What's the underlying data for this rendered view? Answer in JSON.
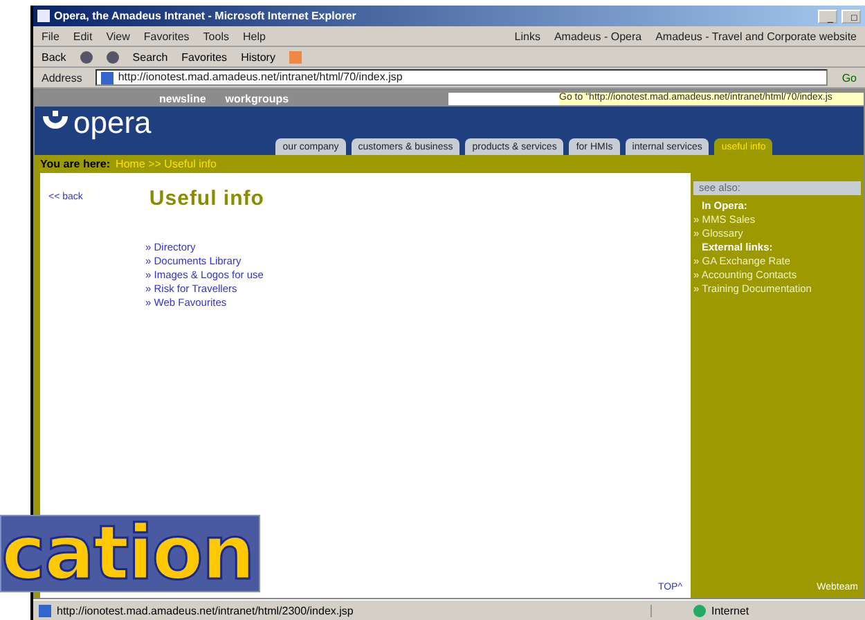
{
  "window": {
    "title": "Opera, the Amadeus Intranet - Microsoft Internet Explorer",
    "controls": [
      "_",
      "□"
    ]
  },
  "menu": [
    {
      "label": "File"
    },
    {
      "label": "Edit"
    },
    {
      "label": "View"
    },
    {
      "label": "Favorites"
    },
    {
      "label": "Tools"
    },
    {
      "label": "Help"
    }
  ],
  "links_bar": {
    "label": "Links",
    "items": [
      "Amadeus - Opera",
      "Amadeus - Travel and Corporate website"
    ]
  },
  "toolbar": {
    "back": "Back",
    "buttons": [
      "Search",
      "Favorites",
      "History"
    ]
  },
  "address": {
    "label": "Address",
    "value": "http://ionotest.mad.amadeus.net/intranet/html/70/index.jsp",
    "go": "Go"
  },
  "site": {
    "top_links": [
      "newsline",
      "workgroups"
    ],
    "goto": "Go to \"http://ionotest.mad.amadeus.net/intranet/html/70/index.js",
    "logo": "opera",
    "tabs": [
      {
        "label": "our company",
        "selected": false
      },
      {
        "label": "customers & business",
        "selected": false
      },
      {
        "label": "products & services",
        "selected": false
      },
      {
        "label": "for HMIs",
        "selected": false
      },
      {
        "label": "internal services",
        "selected": false
      },
      {
        "label": "useful info",
        "selected": true
      }
    ],
    "breadcrumb": {
      "label": "You are here:",
      "path": "Home >> Useful info"
    },
    "back": "<< back",
    "heading": "Useful info",
    "links": [
      "» Directory",
      "» Documents Library",
      "» Images & Logos for use",
      "» Risk for Travellers",
      "» Web Favourites"
    ],
    "top": "TOP^",
    "sidebar": {
      "title": "see also:",
      "groups": [
        {
          "heading": "In Opera:",
          "items": [
            "» MMS Sales",
            "» Glossary"
          ]
        },
        {
          "heading": "External links:",
          "items": [
            "» GA Exchange Rate",
            "» Accounting Contacts",
            "» Training Documentation"
          ]
        }
      ],
      "footer": "Webteam"
    }
  },
  "status_bar": {
    "url": "http://ionotest.mad.amadeus.net/intranet/html/2300/index.jsp",
    "zone": "Internet"
  },
  "overlay": {
    "text": "cation"
  }
}
